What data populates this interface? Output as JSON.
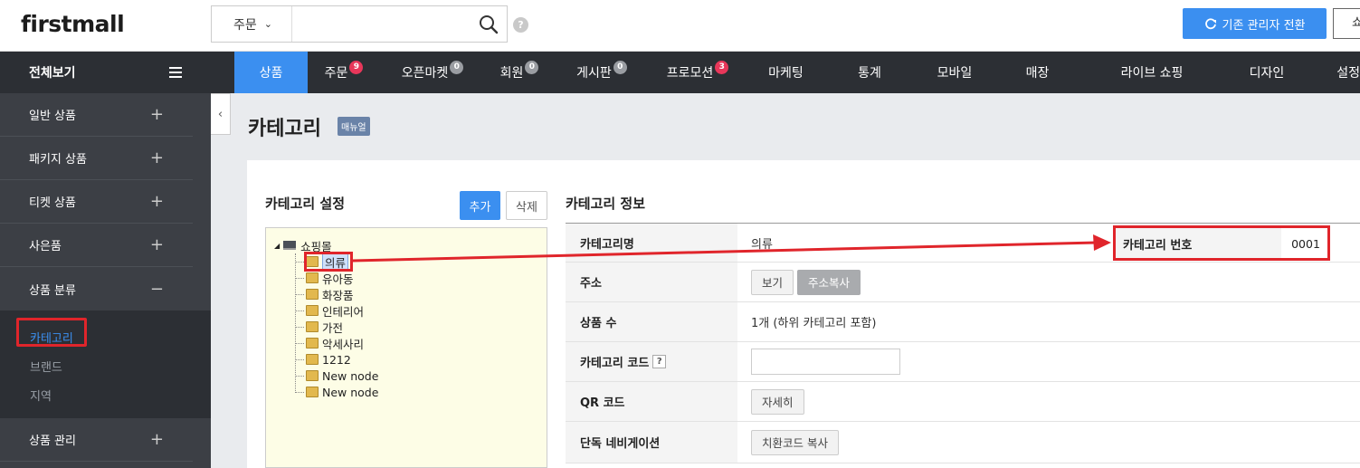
{
  "header": {
    "logo": "firstmall",
    "search_select": "주문",
    "search_placeholder": "",
    "help": "?",
    "switch_button": "기존 관리자 전환",
    "right_button": "쇼"
  },
  "sidebar": {
    "title": "전체보기",
    "items": [
      {
        "label": "일반 상품",
        "sym": "+"
      },
      {
        "label": "패키지 상품",
        "sym": "+"
      },
      {
        "label": "티켓 상품",
        "sym": "+"
      },
      {
        "label": "사은품",
        "sym": "+"
      },
      {
        "label": "상품 분류",
        "sym": "−"
      }
    ],
    "sub_items": [
      {
        "label": "카테고리"
      },
      {
        "label": "브랜드"
      },
      {
        "label": "지역"
      }
    ],
    "after_item": {
      "label": "상품 관리",
      "sym": "+"
    }
  },
  "nav": {
    "items": [
      {
        "label": "상품",
        "badge": ""
      },
      {
        "label": "주문",
        "badge": "9"
      },
      {
        "label": "오픈마켓",
        "badge": "0"
      },
      {
        "label": "회원",
        "badge": "0"
      },
      {
        "label": "게시판",
        "badge": "0"
      },
      {
        "label": "프로모션",
        "badge": "3"
      },
      {
        "label": "마케팅",
        "badge": ""
      },
      {
        "label": "통계",
        "badge": ""
      },
      {
        "label": "모바일",
        "badge": ""
      },
      {
        "label": "매장",
        "badge": ""
      },
      {
        "label": "라이브 쇼핑",
        "badge": ""
      },
      {
        "label": "디자인",
        "badge": ""
      },
      {
        "label": "설정",
        "badge": ""
      }
    ]
  },
  "page": {
    "title": "카테고리",
    "manual": "매뉴얼",
    "collapse": "‹"
  },
  "category_settings": {
    "title": "카테고리 설정",
    "add": "추가",
    "delete": "삭제",
    "tree": {
      "root": "쇼핑몰",
      "nodes": [
        "의류",
        "유아동",
        "화장품",
        "인테리어",
        "가전",
        "악세사리",
        "1212",
        "New node",
        "New node"
      ]
    }
  },
  "category_info": {
    "title": "카테고리 정보",
    "name_label": "카테고리명",
    "name_value": "의류",
    "number_label": "카테고리 번호",
    "number_value": "0001",
    "address_label": "주소",
    "address_view": "보기",
    "address_copy": "주소복사",
    "count_label": "상품 수",
    "count_value": "1개 (하위 카테고리 포함)",
    "code_label": "카테고리 코드",
    "code_help": "?",
    "qr_label": "QR 코드",
    "qr_button": "자세히",
    "nav_label": "단독 네비게이션",
    "nav_button": "치환코드 복사"
  },
  "colors": {
    "accent": "#3b8ff0",
    "highlight": "#e0252b"
  }
}
